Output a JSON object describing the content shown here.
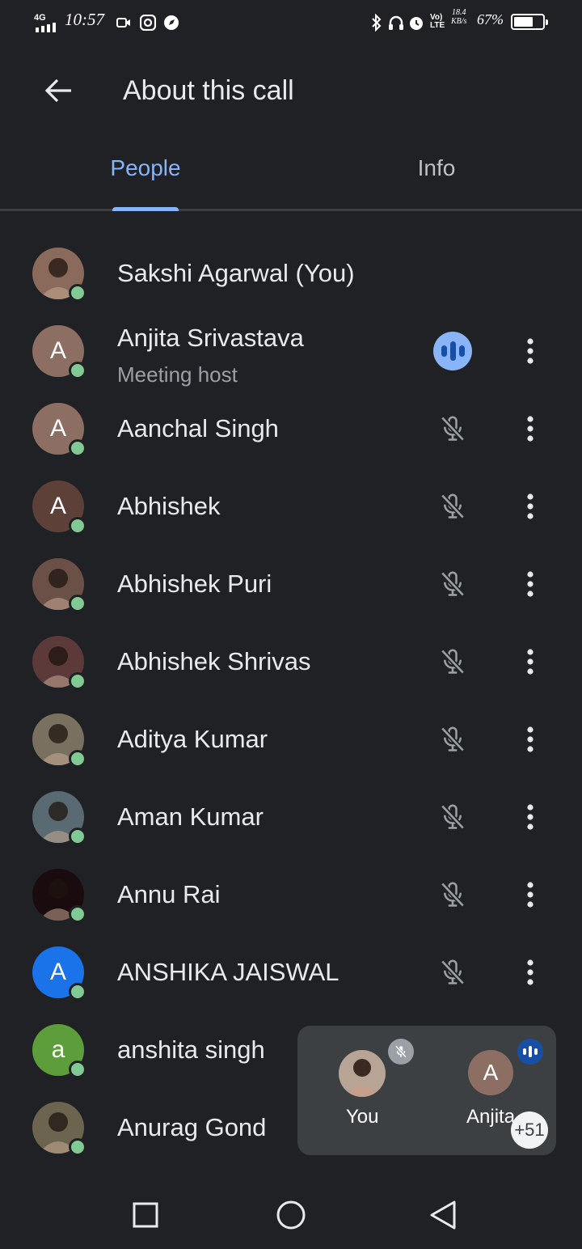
{
  "status_bar": {
    "network": "4G",
    "time": "10:57",
    "speed_value": "18.4",
    "speed_unit": "KB/s",
    "battery": "67%",
    "battery_level": 0.67
  },
  "header": {
    "title": "About this call"
  },
  "tabs": [
    {
      "label": "People",
      "active": true
    },
    {
      "label": "Info",
      "active": false
    }
  ],
  "participants": [
    {
      "name": "Sakshi Agarwal (You)",
      "avatar_letter": "",
      "avatar_color": "#8a6a5a",
      "photo": true,
      "state": "none"
    },
    {
      "name": "Anjita Srivastava",
      "subtitle": "Meeting host",
      "avatar_letter": "A",
      "avatar_color": "#8d6e63",
      "photo": false,
      "state": "speaking"
    },
    {
      "name": "Aanchal Singh",
      "avatar_letter": "A",
      "avatar_color": "#8d6e63",
      "photo": false,
      "state": "muted"
    },
    {
      "name": "Abhishek",
      "avatar_letter": "A",
      "avatar_color": "#5d4037",
      "photo": false,
      "state": "muted"
    },
    {
      "name": "Abhishek Puri",
      "avatar_letter": "",
      "avatar_color": "#6b5048",
      "photo": true,
      "state": "muted"
    },
    {
      "name": "Abhishek Shrivas",
      "avatar_letter": "",
      "avatar_color": "#5c3a3a",
      "photo": true,
      "state": "muted"
    },
    {
      "name": "Aditya Kumar",
      "avatar_letter": "",
      "avatar_color": "#7a7060",
      "photo": true,
      "state": "muted"
    },
    {
      "name": "Aman Kumar",
      "avatar_letter": "",
      "avatar_color": "#5a6a72",
      "photo": true,
      "state": "muted"
    },
    {
      "name": "Annu Rai",
      "avatar_letter": "",
      "avatar_color": "#1a0b0f",
      "photo": true,
      "state": "muted"
    },
    {
      "name": "ANSHIKA JAISWAL",
      "avatar_letter": "A",
      "avatar_color": "#1a73e8",
      "photo": false,
      "state": "muted"
    },
    {
      "name": "anshita singh",
      "avatar_letter": "a",
      "avatar_color": "#5e9e3a",
      "photo": false,
      "state": "none"
    },
    {
      "name": "Anurag Gond",
      "avatar_letter": "",
      "avatar_color": "#6d6450",
      "photo": true,
      "state": "none"
    }
  ],
  "pip": {
    "you_label": "You",
    "other_label": "Anjita",
    "other_letter": "A",
    "extra_count": "+51"
  },
  "icons": {
    "back": "arrow-left-icon",
    "mic_off": "mic-off-icon",
    "more": "more-vert-icon",
    "speaking": "audio-level-icon"
  }
}
